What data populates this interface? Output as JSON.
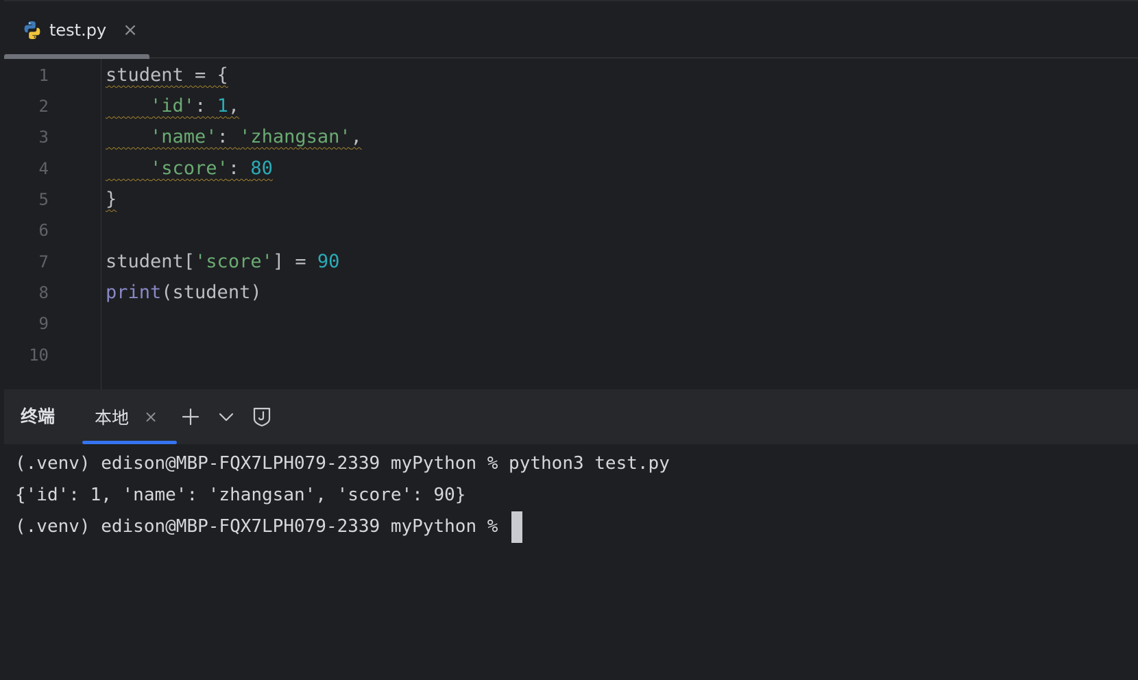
{
  "editor": {
    "tab": {
      "title": "test.py",
      "close_glyph": "×",
      "icon": "python-icon"
    },
    "line_numbers": [
      "1",
      "2",
      "3",
      "4",
      "5",
      "6",
      "7",
      "8",
      "9",
      "10"
    ],
    "code": {
      "line1": "student = {",
      "line2_indent": "    ",
      "line2_key": "'id'",
      "line2_colon": ": ",
      "line2_val": "1",
      "line2_comma": ",",
      "line3_indent": "    ",
      "line3_key": "'name'",
      "line3_colon": ": ",
      "line3_val": "'zhangsan'",
      "line3_comma": ",",
      "line4_indent": "    ",
      "line4_key": "'score'",
      "line4_colon": ": ",
      "line4_val": "80",
      "line5": "}",
      "line7_a": "student[",
      "line7_key": "'score'",
      "line7_b": "] = ",
      "line7_val": "90",
      "line8_fn": "print",
      "line8_rest": "(student)"
    }
  },
  "terminal": {
    "title": "终端",
    "tab_label": "本地",
    "tab_close_glyph": "×",
    "tools": {
      "add": "plus-icon",
      "dropdown": "chevron-down-icon",
      "security": "shield-icon"
    },
    "lines": [
      "(.venv) edison@MBP-FQX7LPH079-2339 myPython % python3 test.py",
      "{'id': 1, 'name': 'zhangsan', 'score': 90}",
      "(.venv) edison@MBP-FQX7LPH079-2339 myPython % "
    ]
  },
  "colors": {
    "background": "#1e1f22",
    "panel_header": "#27282c",
    "accent": "#3574f0",
    "string": "#6aab73",
    "number": "#2aacb8",
    "builtin": "#8888c6"
  }
}
